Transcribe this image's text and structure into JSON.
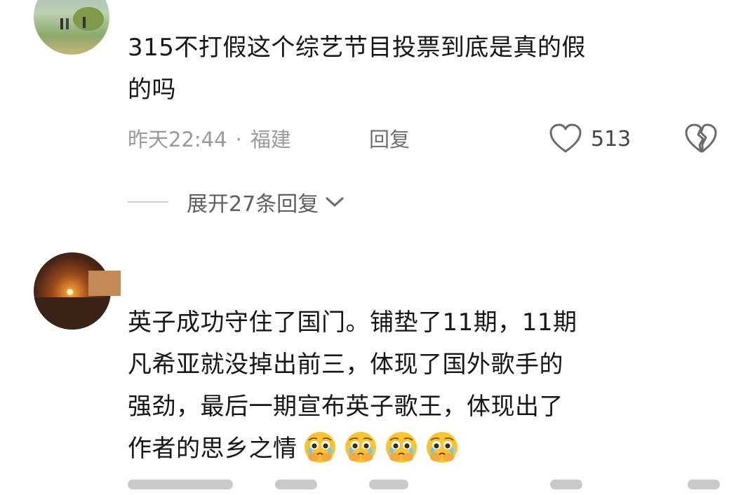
{
  "comments": [
    {
      "text_lines": [
        "315不打假这个综艺节目投票到底是真的假",
        "的吗"
      ],
      "time": "昨天22:44",
      "separator": "·",
      "location": "福建",
      "reply_label": "回复",
      "like_count": "513",
      "expand_label": "展开27条回复"
    },
    {
      "text_lines": [
        "英子成功守住了国门。铺垫了11期，11期",
        "凡希亚就没掉出前三，体现了国外歌手的",
        "强劲，最后一期宣布英子歌王，体现出了",
        "作者的思乡之情"
      ],
      "emoji_icons": [
        "crying-emoji-icon",
        "crying-emoji-icon",
        "crying-emoji-icon",
        "crying-emoji-icon"
      ]
    }
  ],
  "colors": {
    "primary_text": "#161616",
    "meta_text": "#9a9a9a",
    "icon_stroke": "#6a6a6a",
    "emoji_face": "#f7c531"
  }
}
